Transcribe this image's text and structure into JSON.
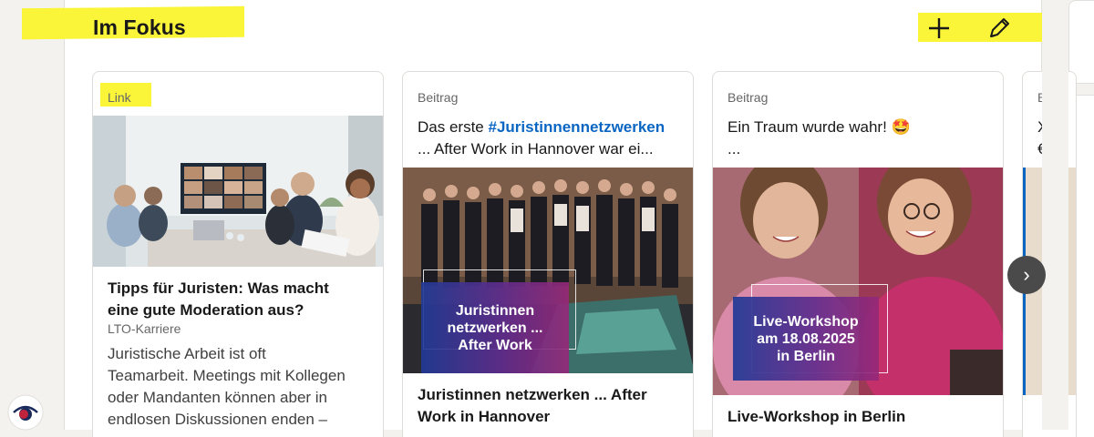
{
  "section": {
    "title": "Im Fokus",
    "add_icon": "plus-icon",
    "edit_icon": "pencil-icon",
    "highlight_color": "#fbf53a"
  },
  "cards": [
    {
      "type": "Link",
      "title_lines": [
        "Tipps für Juristen: Was macht",
        "eine gute Moderation aus?"
      ],
      "source": "LTO-Karriere",
      "description_lines": [
        "Juristische Arbeit ist oft",
        "Teamarbeit. Meetings mit Kollegen",
        "oder Mandanten können aber in",
        "endlosen Diskussionen enden –"
      ]
    },
    {
      "type": "Beitrag",
      "headline_prefix": "Das erste ",
      "headline_hashtag": "#Juristinnennetzwerken",
      "headline_line2": "... After Work in Hannover war ei...",
      "image_overlay_lines": [
        "Juristinnen",
        "netzwerken ...",
        "After Work"
      ],
      "title_lines": [
        "Juristinnen netzwerken ... After",
        "Work in Hannover"
      ]
    },
    {
      "type": "Beitrag",
      "headline": "Ein Traum wurde wahr! 🤩",
      "headline_line2": "...",
      "image_overlay_lines": [
        "Live-Workshop",
        "am 18.08.2025",
        "in Berlin"
      ],
      "title_lines": [
        "Live-Workshop in Berlin"
      ]
    },
    {
      "type": "B",
      "headline": "X",
      "headline_line2": "€"
    }
  ],
  "next_button": "›",
  "colors": {
    "hashtag": "#0a66c2",
    "accent_blue": "#0a66c2"
  }
}
